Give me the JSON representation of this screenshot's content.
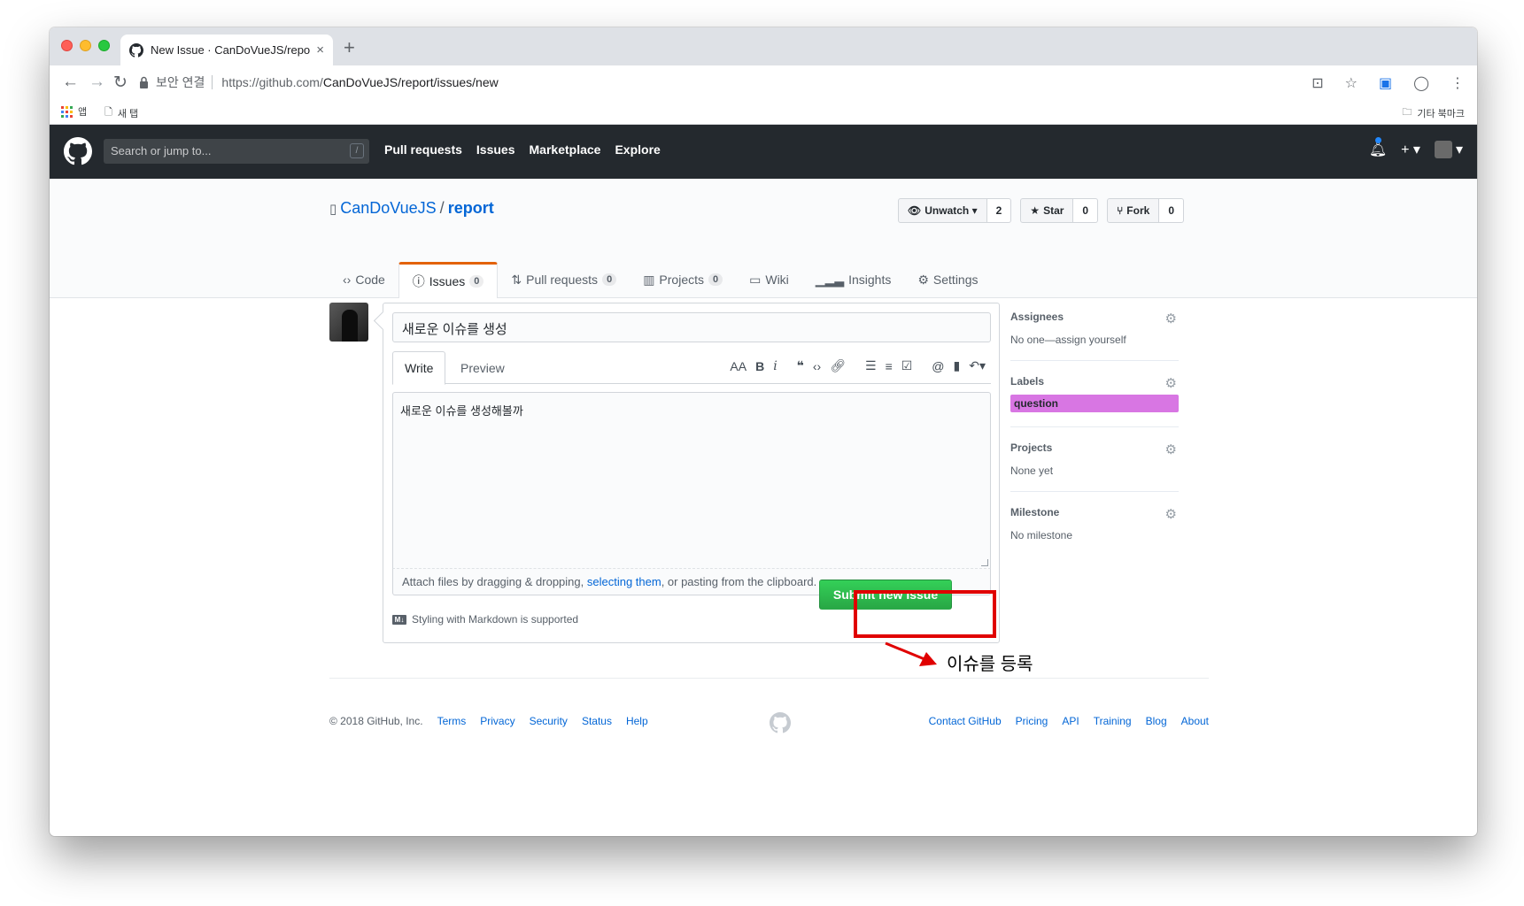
{
  "browser": {
    "tab_title": "New Issue · CanDoVueJS/repor",
    "tab_close": "×",
    "new_tab": "+",
    "secure_label": "보안 연결",
    "url_host": "https://github.com/",
    "url_path": "CanDoVueJS/report/issues/new",
    "bookmarks": {
      "apps": "앱",
      "newtab": "새 탭",
      "other": "기타 북마크"
    }
  },
  "github_header": {
    "search_placeholder": "Search or jump to...",
    "slash": "/",
    "nav": [
      "Pull requests",
      "Issues",
      "Marketplace",
      "Explore"
    ],
    "plus": "+ ▾"
  },
  "repo": {
    "owner": "CanDoVueJS",
    "separator": "/",
    "name": "report",
    "unwatch_label": "Unwatch ▾",
    "unwatch_count": "2",
    "star_label": "Star",
    "star_count": "0",
    "fork_label": "Fork",
    "fork_count": "0",
    "tabs": [
      {
        "label": "Code",
        "count": ""
      },
      {
        "label": "Issues",
        "count": "0"
      },
      {
        "label": "Pull requests",
        "count": "0"
      },
      {
        "label": "Projects",
        "count": "0"
      },
      {
        "label": "Wiki",
        "count": ""
      },
      {
        "label": "Insights",
        "count": ""
      },
      {
        "label": "Settings",
        "count": ""
      }
    ]
  },
  "issue_form": {
    "title_value": "새로운 이슈를 생성",
    "tab_write": "Write",
    "tab_preview": "Preview",
    "body_value": "새로운 이슈를 생성해볼까",
    "drag_text_before": "Attach files by dragging & dropping, ",
    "drag_link": "selecting them",
    "drag_text_after": ", or pasting from the clipboard.",
    "markdown_note": "Styling with Markdown is supported",
    "submit_label": "Submit new issue"
  },
  "annotation": {
    "text": "이슈를 등록",
    "color": "#e00000"
  },
  "sidebar": {
    "assignees": {
      "heading": "Assignees",
      "value": "No one—assign yourself"
    },
    "labels": {
      "heading": "Labels",
      "value": "question",
      "color": "#d876e3"
    },
    "projects": {
      "heading": "Projects",
      "value": "None yet"
    },
    "milestone": {
      "heading": "Milestone",
      "value": "No milestone"
    }
  },
  "footer": {
    "copyright": "© 2018 GitHub, Inc.",
    "left_links": [
      "Terms",
      "Privacy",
      "Security",
      "Status",
      "Help"
    ],
    "right_links": [
      "Contact GitHub",
      "Pricing",
      "API",
      "Training",
      "Blog",
      "About"
    ]
  },
  "colors": {
    "header_bg": "#24292e",
    "accent_tab": "#e36209",
    "submit_green": "#28a745",
    "link": "#0366d6"
  }
}
